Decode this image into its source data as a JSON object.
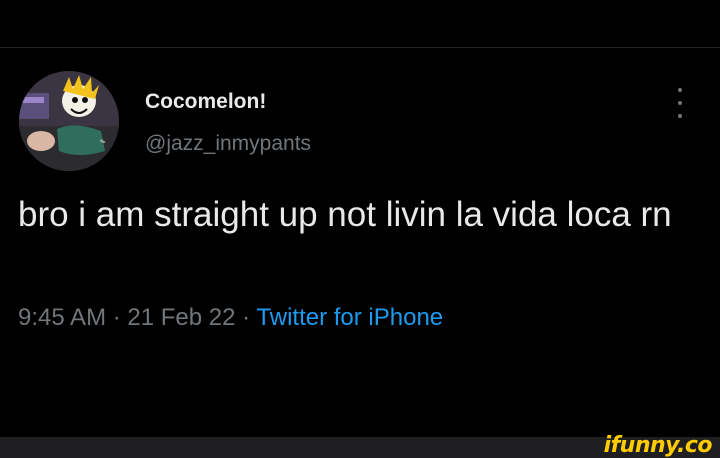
{
  "tweet": {
    "author": {
      "display_name": "Cocomelon!",
      "username": "@jazz_inmypants",
      "avatar_icon": "cartoon-avatar"
    },
    "menu_icon": "more-vertical-icon",
    "text": "bro i am straight up not livin la vida loca rn",
    "time": "9:45 AM",
    "date": "21 Feb 22",
    "separator": "·",
    "source": "Twitter for iPhone"
  },
  "watermark": {
    "text": "ifunny.co"
  },
  "colors": {
    "background": "#000000",
    "primary_text": "#e7e9ea",
    "secondary_text": "#71767b",
    "link": "#1d9bf0",
    "watermark": "#ffcc00"
  }
}
